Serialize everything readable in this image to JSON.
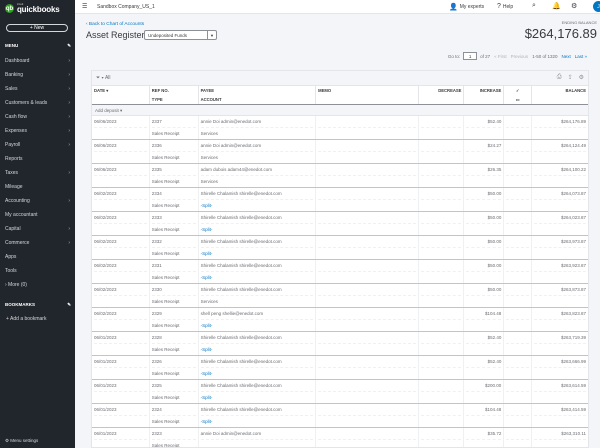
{
  "brand": {
    "intuit": "intuit",
    "name": "quickbooks"
  },
  "sidebar": {
    "new_label": "+ New",
    "menu_label": "MENU",
    "items": [
      {
        "label": "Dashboard",
        "chevron": true
      },
      {
        "label": "Banking",
        "chevron": true
      },
      {
        "label": "Sales",
        "chevron": true
      },
      {
        "label": "Customers & leads",
        "chevron": true
      },
      {
        "label": "Cash flow",
        "chevron": true
      },
      {
        "label": "Expenses",
        "chevron": true
      },
      {
        "label": "Payroll",
        "chevron": true
      },
      {
        "label": "Reports",
        "chevron": false
      },
      {
        "label": "Taxes",
        "chevron": true
      },
      {
        "label": "Mileage",
        "chevron": false
      },
      {
        "label": "Accounting",
        "chevron": true
      },
      {
        "label": "My accountant",
        "chevron": false
      },
      {
        "label": "Capital",
        "chevron": true
      },
      {
        "label": "Commerce",
        "chevron": true
      },
      {
        "label": "Apps",
        "chevron": false
      },
      {
        "label": "Tools",
        "chevron": false
      },
      {
        "label": "› More (0)",
        "chevron": false
      }
    ],
    "bookmarks_label": "BOOKMARKS",
    "add_bookmark": "+ Add a bookmark",
    "menu_settings": "⚙ Menu settings"
  },
  "topbar": {
    "company": "Sandbox Company_US_1",
    "my_experts": "My experts",
    "help": "Help",
    "avatar_initial": "J"
  },
  "header": {
    "back_link": "‹ Back to Chart of Accounts",
    "title": "Asset Register",
    "account_selected": "Undeposited Funds",
    "ending_balance_label": "ENDING BALANCE",
    "ending_balance_value": "$264,176.89"
  },
  "pager": {
    "go_to": "Go to:",
    "page": "1",
    "of": "of 27",
    "first": "« First",
    "previous": "Previous",
    "range": "1-50 of 1320",
    "next": "Next",
    "last": "Last »"
  },
  "register": {
    "filter_label": "All",
    "headers": {
      "date": "DATE ▾",
      "ref_no": "REF NO.",
      "type": "TYPE",
      "payee": "PAYEE",
      "account": "ACCOUNT",
      "memo": "MEMO",
      "decrease": "DECREASE",
      "increase": "INCREASE",
      "balance": "BALANCE"
    },
    "add_deposit": "Add deposit ▾",
    "rows": [
      {
        "date": "06/06/2023",
        "ref": "2337",
        "type": "Sales Receipt",
        "payee": "annie Doi admin@enedot.com",
        "account": "Services",
        "increase": "$52.40",
        "balance": "$264,176.89"
      },
      {
        "date": "06/06/2023",
        "ref": "2336",
        "type": "Sales Receipt",
        "payee": "annie Doi admin@enedot.com",
        "account": "Services",
        "increase": "$24.27",
        "balance": "$264,124.49"
      },
      {
        "date": "06/06/2023",
        "ref": "2335",
        "type": "Sales Receipt",
        "payee": "adam dubois adam44@enedot.com",
        "account": "Services",
        "increase": "$26.35",
        "balance": "$264,100.22"
      },
      {
        "date": "06/02/2023",
        "ref": "2334",
        "type": "Sales Receipt",
        "payee": "Shirelle Chalamish shirelle@enedot.com",
        "account": "-Split-",
        "increase": "$50.00",
        "balance": "$264,073.87"
      },
      {
        "date": "06/02/2023",
        "ref": "2333",
        "type": "Sales Receipt",
        "payee": "Shirelle Chalamish shirelle@enedot.com",
        "account": "-Split-",
        "increase": "$50.00",
        "balance": "$264,023.87"
      },
      {
        "date": "06/02/2023",
        "ref": "2332",
        "type": "Sales Receipt",
        "payee": "Shirelle Chalamish shirelle@enedot.com",
        "account": "-Split-",
        "increase": "$50.00",
        "balance": "$263,973.87"
      },
      {
        "date": "06/02/2023",
        "ref": "2331",
        "type": "Sales Receipt",
        "payee": "Shirelle Chalamish shirelle@enedot.com",
        "account": "-Split-",
        "increase": "$50.00",
        "balance": "$263,923.87"
      },
      {
        "date": "06/02/2023",
        "ref": "2330",
        "type": "Sales Receipt",
        "payee": "Shirelle Chalamish shirelle@enedot.com",
        "account": "Services",
        "increase": "$50.00",
        "balance": "$263,873.87"
      },
      {
        "date": "06/02/2023",
        "ref": "2329",
        "type": "Sales Receipt",
        "payee": "shell peng shellie@enedot.com",
        "account": "-Split-",
        "increase": "$104.48",
        "balance": "$263,823.87"
      },
      {
        "date": "06/01/2023",
        "ref": "2328",
        "type": "Sales Receipt",
        "payee": "Shirelle Chalamish shirelle@enedot.com",
        "account": "-Split-",
        "increase": "$52.40",
        "balance": "$263,719.39"
      },
      {
        "date": "06/01/2023",
        "ref": "2326",
        "type": "Sales Receipt",
        "payee": "Shirelle Chalamish shirelle@enedot.com",
        "account": "-Split-",
        "increase": "$52.40",
        "balance": "$263,666.99"
      },
      {
        "date": "06/01/2023",
        "ref": "2325",
        "type": "Sales Receipt",
        "payee": "Shirelle Chalamish shirelle@enedot.com",
        "account": "-Split-",
        "increase": "$200.00",
        "balance": "$263,614.59"
      },
      {
        "date": "06/01/2023",
        "ref": "2324",
        "type": "Sales Receipt",
        "payee": "Shirelle Chalamish shirelle@enedot.com",
        "account": "-Split-",
        "increase": "$104.48",
        "balance": "$263,414.59"
      },
      {
        "date": "06/01/2023",
        "ref": "2323",
        "type": "Sales Receipt",
        "payee": "annie Doi admin@enedot.com",
        "account": "",
        "increase": "$35.72",
        "balance": "$263,310.11"
      }
    ]
  }
}
